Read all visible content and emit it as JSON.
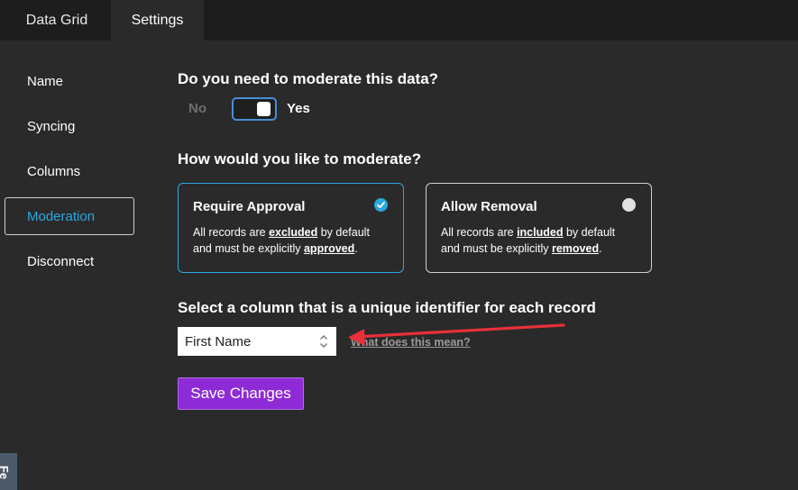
{
  "tabs": [
    {
      "label": "Data Grid",
      "active": false
    },
    {
      "label": "Settings",
      "active": true
    }
  ],
  "sidebar": {
    "items": [
      {
        "label": "Name"
      },
      {
        "label": "Syncing"
      },
      {
        "label": "Columns"
      },
      {
        "label": "Moderation",
        "active": true
      },
      {
        "label": "Disconnect"
      }
    ]
  },
  "moderation": {
    "question": "Do you need to moderate this data?",
    "toggle_off_label": "No",
    "toggle_on_label": "Yes",
    "toggle_state": "on",
    "how_heading": "How would you like to moderate?",
    "options": [
      {
        "title": "Require Approval",
        "desc_pre": "All records are ",
        "desc_em1": "excluded",
        "desc_mid": " by default and must be explicitly ",
        "desc_em2": "approved",
        "desc_end": ".",
        "selected": true
      },
      {
        "title": "Allow Removal",
        "desc_pre": "All records are ",
        "desc_em1": "included",
        "desc_mid": " by default and must be explicitly ",
        "desc_em2": "removed",
        "desc_end": ".",
        "selected": false
      }
    ],
    "column_heading": "Select a column that is a unique identifier for each record",
    "column_value": "First Name",
    "help_link": "What does this mean?",
    "save_label": "Save Changes"
  },
  "feedback_tab_label": "Fe",
  "colors": {
    "accent": "#29a8e0",
    "save_button": "#8e2bd6",
    "annotation_arrow": "#e8303a",
    "background": "#2a2a2a"
  }
}
